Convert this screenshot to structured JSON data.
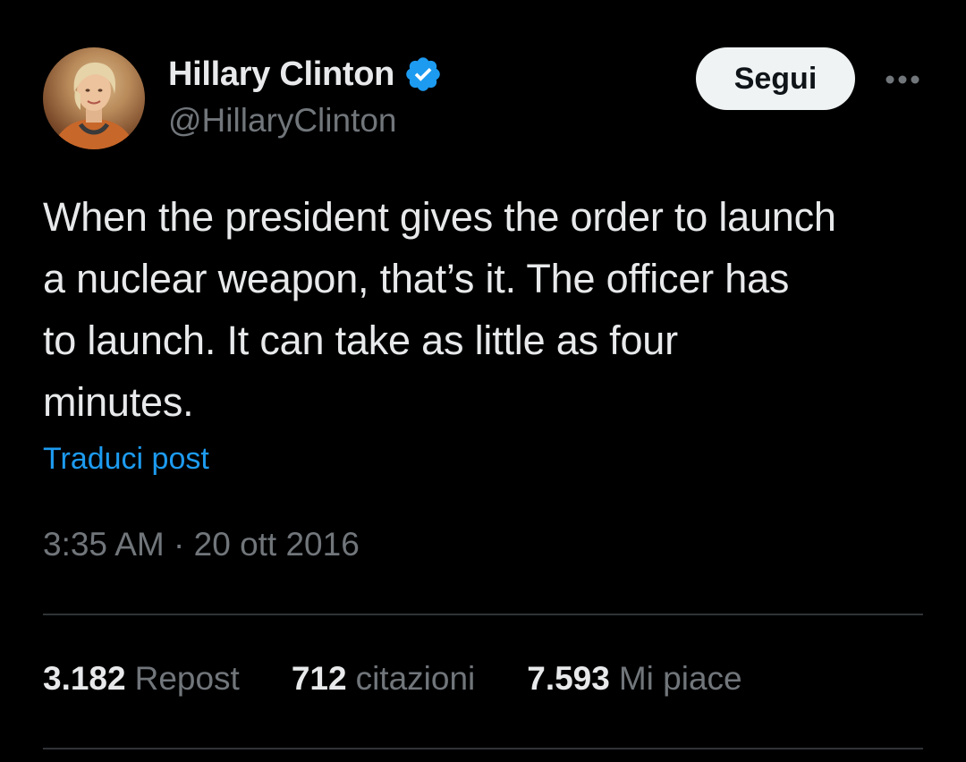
{
  "author": {
    "display_name": "Hillary Clinton",
    "handle": "@HillaryClinton",
    "verified": true,
    "verified_color": "#1d9bf0"
  },
  "follow_button": {
    "label": "Segui"
  },
  "more_button": {
    "icon": "more-horizontal-icon"
  },
  "tweet": {
    "text_lines": [
      "When the president gives the order to launch",
      "a nuclear weapon, that’s it. The officer has",
      "to launch. It can take as little as four",
      "minutes."
    ],
    "translate_label": "Traduci post",
    "timestamp": "3:35 AM · 20 ott 2016"
  },
  "stats": [
    {
      "value": "3.182",
      "label": "Repost"
    },
    {
      "value": "712",
      "label": "citazioni"
    },
    {
      "value": "7.593",
      "label": "Mi piace"
    }
  ],
  "colors": {
    "background": "#000000",
    "text_primary": "#e7e9ea",
    "text_secondary": "#71767b",
    "link": "#1d9bf0",
    "divider": "#2f3336"
  }
}
